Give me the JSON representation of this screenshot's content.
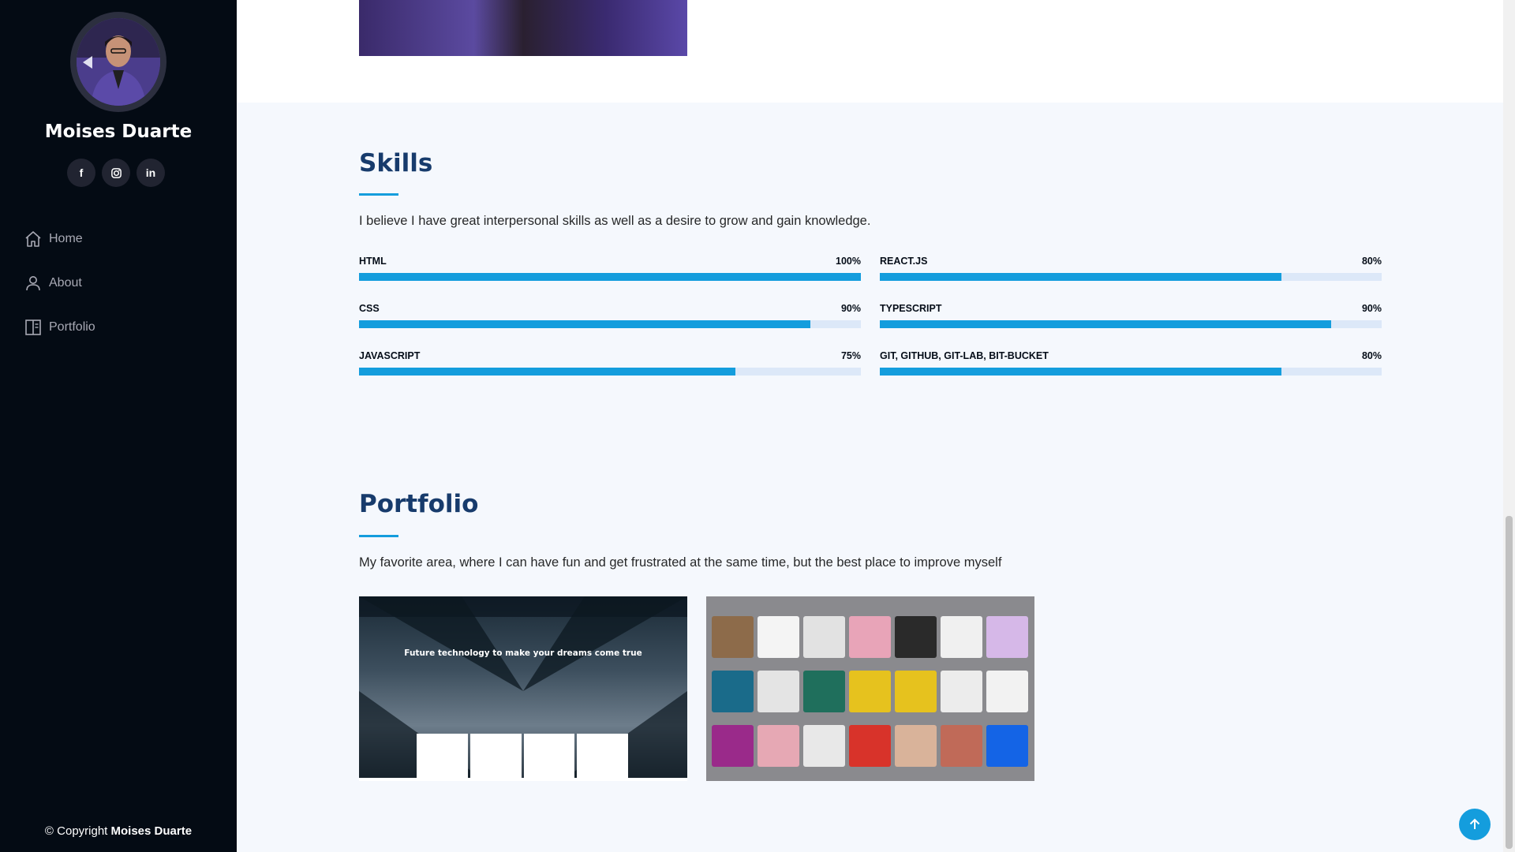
{
  "profile": {
    "name": "Moises Duarte",
    "social": [
      {
        "icon": "facebook-icon",
        "glyph": "f"
      },
      {
        "icon": "instagram-icon",
        "glyph": "◎"
      },
      {
        "icon": "linkedin-icon",
        "glyph": "in"
      }
    ]
  },
  "nav": {
    "items": [
      {
        "label": "Home",
        "icon": "home-icon"
      },
      {
        "label": "About",
        "icon": "person-icon"
      },
      {
        "label": "Portfolio",
        "icon": "book-icon"
      }
    ]
  },
  "footer": {
    "prefix": "© Copyright ",
    "owner": "Moises Duarte"
  },
  "skills": {
    "title": "Skills",
    "description": "I believe I have great interpersonal skills as well as a desire to grow and gain knowledge.",
    "items": [
      {
        "name": "HTML",
        "percent": "100%",
        "value": 100
      },
      {
        "name": "REACT.JS",
        "percent": "80%",
        "value": 80
      },
      {
        "name": "CSS",
        "percent": "90%",
        "value": 90
      },
      {
        "name": "TYPESCRIPT",
        "percent": "90%",
        "value": 90
      },
      {
        "name": "JAVASCRIPT",
        "percent": "75%",
        "value": 75
      },
      {
        "name": "GIT, GITHUB, GIT-LAB, BIT-BUCKET",
        "percent": "80%",
        "value": 80
      }
    ]
  },
  "portfolio": {
    "title": "Portfolio",
    "description": "My favorite area, where I can have fun and get frustrated at the same time, but the best place to improve myself",
    "card1": {
      "headline": "Future technology to make your dreams come true"
    }
  },
  "colors": {
    "accent": "#149ddd",
    "sidebar": "#040b14",
    "heading": "#173b6c"
  }
}
